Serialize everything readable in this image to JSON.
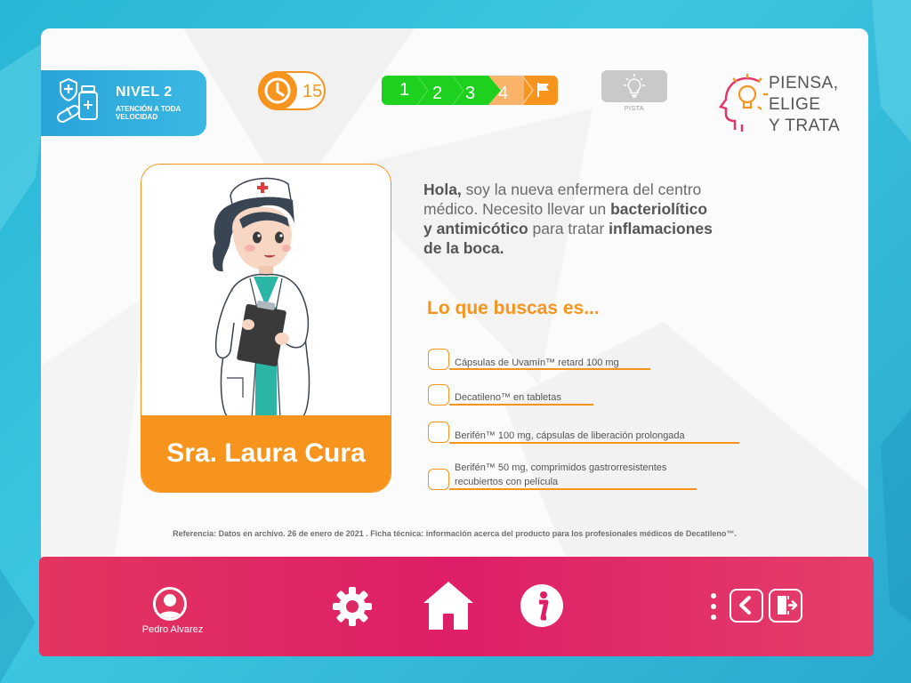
{
  "level": {
    "title": "NIVEL 2",
    "subtitle": "ATENCIÓN A TODA VELOCIDAD",
    "icon": "medicine-icon"
  },
  "timer": {
    "value": "15",
    "icon": "clock-icon",
    "color": "#f7941d"
  },
  "progress": {
    "steps": [
      "1",
      "2",
      "3",
      "4"
    ],
    "completed": 3,
    "finish_icon": "flag-icon",
    "colors": {
      "done": "#1fd11f",
      "current": "#f7941d",
      "pending": "#f9b36a"
    }
  },
  "hint": {
    "label": "PISTA",
    "icon": "lightbulb-icon"
  },
  "logo": {
    "lines": [
      "PIENSA,",
      "ELIGE",
      "Y TRATA"
    ],
    "icon": "head-lightbulb-icon"
  },
  "character": {
    "name": "Sra. Laura Cura",
    "image": "nurse-illustration"
  },
  "speech": {
    "part1_bold": "Hola,",
    "part2": " soy la nueva enfermera del centro médico. Necesito llevar un ",
    "part3_bold": "bacteriolítico y antimicótico",
    "part4": " para tratar ",
    "part5_bold": "inflamaciones de la boca."
  },
  "question": "Lo que buscas es...",
  "options": [
    {
      "label": "Cápsulas de Uvamín™ retard 100 mg"
    },
    {
      "label": "Decatileno™ en tabletas"
    },
    {
      "label": "Berifén™ 100 mg, cápsulas de liberación prolongada"
    },
    {
      "label_line1": "Berifén™ 50 mg, comprimidos gastrorresistentes",
      "label_line2": "recubiertos con película"
    }
  ],
  "reference": "Referencia: Datos en archivo. 26 de enero de 2021 . Ficha técnica: información acerca del producto para los profesionales médicos de Decatileno™.",
  "bottom_bar": {
    "user_name": "Pedro Alvarez",
    "icons": [
      "settings-icon",
      "home-icon",
      "info-icon",
      "more-icon",
      "back-icon",
      "exit-icon"
    ],
    "color": "#de1e68"
  }
}
